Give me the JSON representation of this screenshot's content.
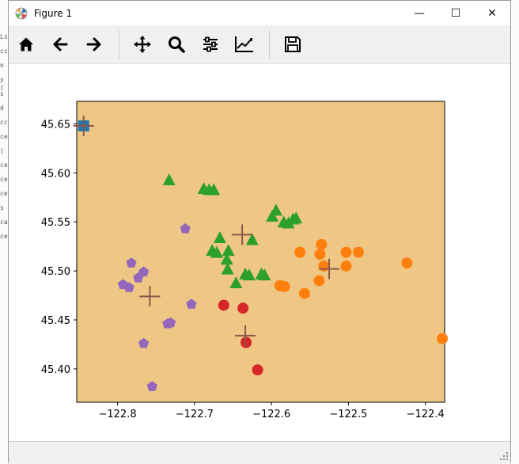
{
  "window": {
    "title": "Figure 1",
    "controls": {
      "minimize": "—",
      "maximize": "☐",
      "close": "✕"
    }
  },
  "left_strip_fragments": [
    "Ls",
    "cc",
    "n",
    "y (",
    "s",
    "d",
    "cc",
    "ce",
    "(",
    "ce",
    "ce",
    "ce",
    "s",
    "ca",
    "ce"
  ],
  "toolbar": {
    "items": [
      "home-icon",
      "back-arrow-icon",
      "forward-arrow-icon",
      "pan-icon",
      "zoom-icon",
      "subplots-icon",
      "edit-curves-icon",
      "save-icon"
    ]
  },
  "status_text": "",
  "chart_data": {
    "type": "scatter",
    "title": "",
    "xlabel": "",
    "ylabel": "",
    "xlim": [
      -122.853,
      -122.375
    ],
    "ylim": [
      45.366,
      45.673
    ],
    "xticks": [
      -122.8,
      -122.7,
      -122.6,
      -122.5,
      -122.4
    ],
    "xtick_labels": [
      "−122.8",
      "−122.7",
      "−122.6",
      "−122.5",
      "−122.4"
    ],
    "yticks": [
      45.4,
      45.45,
      45.5,
      45.55,
      45.6,
      45.65
    ],
    "ytick_labels": [
      "45.40",
      "45.45",
      "45.50",
      "45.55",
      "45.60",
      "45.65"
    ],
    "background": "street map basemap",
    "grid": false,
    "series": [
      {
        "color": "#1f77b4",
        "marker": "square",
        "points": [
          [
            -122.844,
            45.648
          ]
        ]
      },
      {
        "color": "#ff7f0e",
        "marker": "circle",
        "points": [
          [
            -122.378,
            45.431
          ],
          [
            -122.424,
            45.508
          ],
          [
            -122.487,
            45.519
          ],
          [
            -122.503,
            45.519
          ],
          [
            -122.503,
            45.505
          ],
          [
            -122.532,
            45.505
          ],
          [
            -122.535,
            45.527
          ],
          [
            -122.537,
            45.517
          ],
          [
            -122.538,
            45.49
          ],
          [
            -122.563,
            45.519
          ],
          [
            -122.557,
            45.477
          ],
          [
            -122.583,
            45.484
          ],
          [
            -122.589,
            45.485
          ]
        ]
      },
      {
        "color": "#2ca02c",
        "marker": "triangle",
        "points": [
          [
            -122.733,
            45.593
          ],
          [
            -122.688,
            45.584
          ],
          [
            -122.681,
            45.583
          ],
          [
            -122.675,
            45.583
          ],
          [
            -122.594,
            45.562
          ],
          [
            -122.584,
            45.55
          ],
          [
            -122.578,
            45.549
          ],
          [
            -122.599,
            45.556
          ],
          [
            -122.572,
            45.553
          ],
          [
            -122.568,
            45.554
          ],
          [
            -122.667,
            45.534
          ],
          [
            -122.656,
            45.521
          ],
          [
            -122.658,
            45.512
          ],
          [
            -122.671,
            45.519
          ],
          [
            -122.677,
            45.521
          ],
          [
            -122.657,
            45.502
          ],
          [
            -122.646,
            45.488
          ],
          [
            -122.629,
            45.496
          ],
          [
            -122.634,
            45.497
          ],
          [
            -122.613,
            45.497
          ],
          [
            -122.609,
            45.496
          ],
          [
            -122.625,
            45.532
          ]
        ]
      },
      {
        "color": "#d62728",
        "marker": "circle",
        "points": [
          [
            -122.662,
            45.465
          ],
          [
            -122.637,
            45.462
          ],
          [
            -122.633,
            45.427
          ],
          [
            -122.618,
            45.399
          ]
        ]
      },
      {
        "color": "#9467bd",
        "marker": "pentagon",
        "points": [
          [
            -122.785,
            45.483
          ],
          [
            -122.793,
            45.486
          ],
          [
            -122.782,
            45.508
          ],
          [
            -122.773,
            45.493
          ],
          [
            -122.766,
            45.499
          ],
          [
            -122.712,
            45.543
          ],
          [
            -122.735,
            45.446
          ],
          [
            -122.731,
            45.447
          ],
          [
            -122.704,
            45.466
          ],
          [
            -122.766,
            45.426
          ],
          [
            -122.755,
            45.382
          ]
        ]
      },
      {
        "color": "#8c564b",
        "marker": "plus",
        "points": [
          [
            -122.844,
            45.648
          ],
          [
            -122.525,
            45.502
          ],
          [
            -122.638,
            45.537
          ],
          [
            -122.758,
            45.474
          ],
          [
            -122.634,
            45.434
          ]
        ]
      }
    ]
  }
}
